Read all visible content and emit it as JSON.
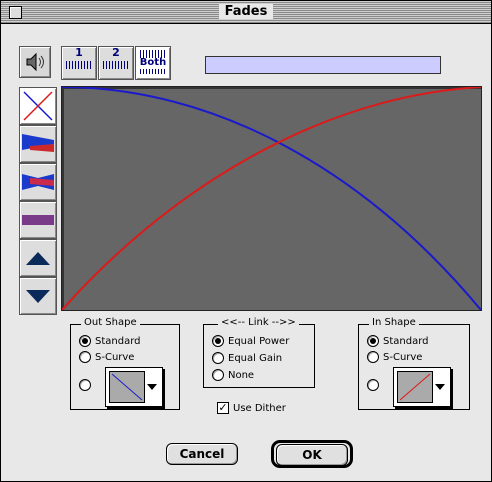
{
  "window": {
    "title": "Fades"
  },
  "toolbar": {
    "track1": "1",
    "track2": "2",
    "both": "Both"
  },
  "out_shape": {
    "legend": "Out Shape",
    "options": [
      "Standard",
      "S-Curve"
    ],
    "selected": "Standard"
  },
  "link": {
    "legend": "<<-- Link -->>",
    "options": [
      "Equal Power",
      "Equal Gain",
      "None"
    ],
    "selected": "Equal Power"
  },
  "in_shape": {
    "legend": "In Shape",
    "options": [
      "Standard",
      "S-Curve"
    ],
    "selected": "Standard"
  },
  "use_dither": {
    "label": "Use Dither",
    "checked": true
  },
  "buttons": {
    "cancel": "Cancel",
    "ok": "OK"
  },
  "colors": {
    "fade_out": "#1a1acc",
    "fade_in": "#dd1a1a",
    "graph_bg": "#666666",
    "name_field": "#ccccff"
  },
  "icons": [
    "close-box-icon",
    "speaker-icon",
    "crossfade-icon",
    "fade-out-waveform-icon",
    "crossfade-waveform-icon",
    "flat-bar-icon",
    "up-arrow-icon",
    "down-arrow-icon",
    "chevron-down-icon"
  ]
}
